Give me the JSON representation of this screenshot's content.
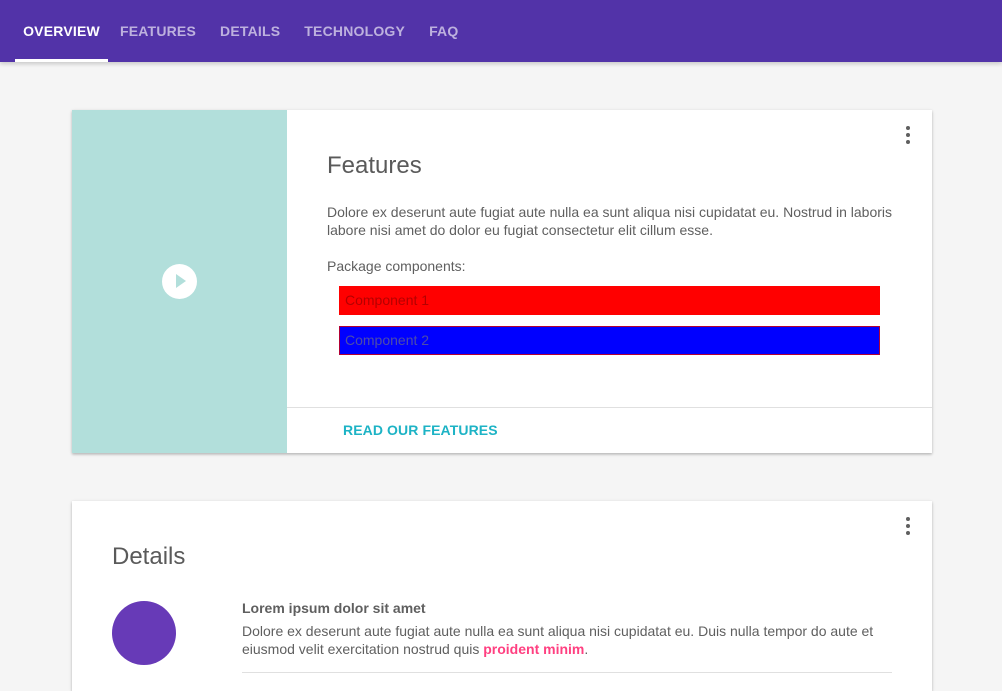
{
  "nav": {
    "tabs": [
      {
        "label": "OVERVIEW",
        "active": true
      },
      {
        "label": "FEATURES",
        "active": false
      },
      {
        "label": "DETAILS",
        "active": false
      },
      {
        "label": "TECHNOLOGY",
        "active": false
      },
      {
        "label": "FAQ",
        "active": false
      }
    ],
    "colors": {
      "background": "#5233a8",
      "active_text": "#ffffff",
      "inactive_text": "#b8a9e4"
    }
  },
  "features_card": {
    "menu_icon": "more-vert-icon",
    "media_icon": "play-circle-icon",
    "title": "Features",
    "description": "Dolore ex deserunt aute fugiat aute nulla ea sunt aliqua nisi cupidatat eu. Nostrud in laboris labore nisi amet do dolor eu fugiat consectetur elit cillum esse.",
    "package_label": "Package components:",
    "components": [
      {
        "label": "Component 1",
        "background": "#ff0000"
      },
      {
        "label": "Component 2",
        "background": "#0000ff"
      }
    ],
    "action_label": "READ OUR FEATURES",
    "colors": {
      "media_background": "#b2dfdb",
      "action_text": "#1db3c5"
    }
  },
  "details_card": {
    "menu_icon": "more-vert-icon",
    "title": "Details",
    "avatar_color": "#673ab7",
    "item": {
      "heading": "Lorem ipsum dolor sit amet",
      "body_prefix": "Dolore ex deserunt aute fugiat aute nulla ea sunt aliqua nisi cupidatat eu. Duis nulla tempor do aute et eiusmod velit exercitation nostrud quis ",
      "link_text": "proident minim",
      "body_suffix": "."
    },
    "colors": {
      "link_text": "#ff4081"
    }
  }
}
